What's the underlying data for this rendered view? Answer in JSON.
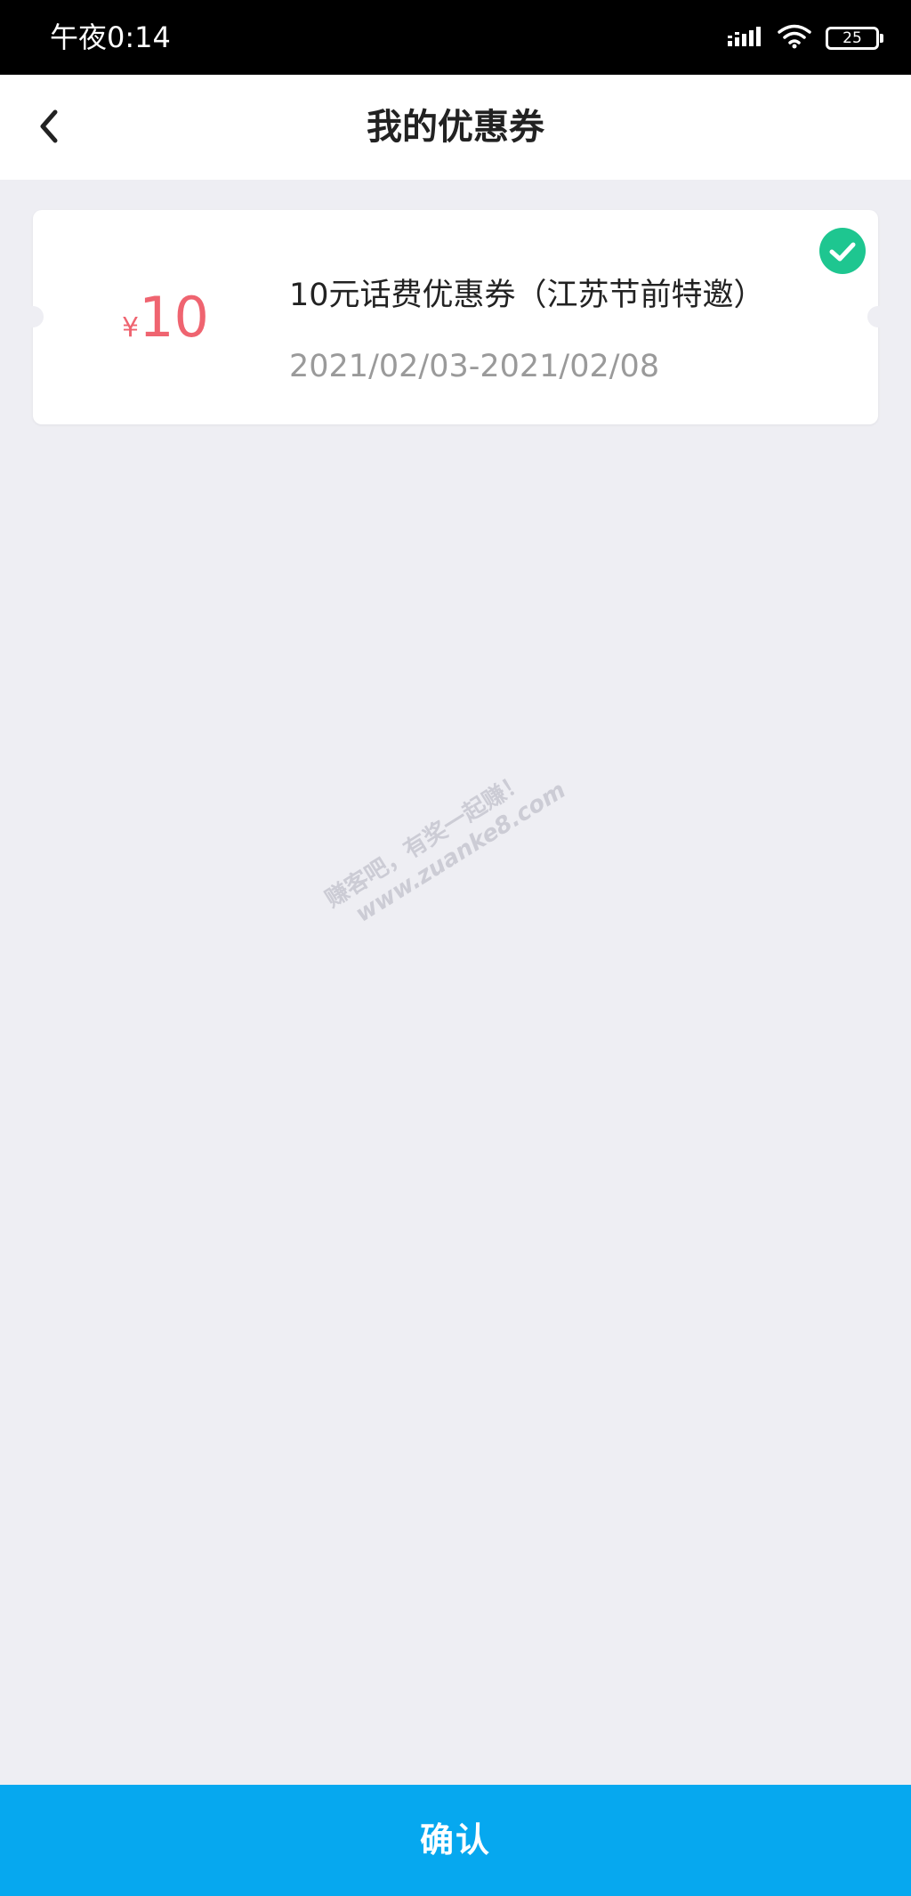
{
  "status_bar": {
    "time": "午夜0:14",
    "battery_level": "25"
  },
  "header": {
    "title": "我的优惠券"
  },
  "coupon": {
    "currency_symbol": "¥",
    "amount": "10",
    "title": "10元话费优惠券（江苏节前特邀）",
    "validity": "2021/02/03-2021/02/08",
    "selected": true,
    "amount_color": "#ef6470",
    "check_color": "#1ec690"
  },
  "watermark": {
    "line1": "赚客吧，有奖一起赚！",
    "line2": "www.zuanke8.com"
  },
  "footer": {
    "confirm_label": "确认",
    "button_color": "#06a8ef"
  },
  "colors": {
    "page_background": "#eeeef3",
    "status_bar_background": "#000000"
  }
}
